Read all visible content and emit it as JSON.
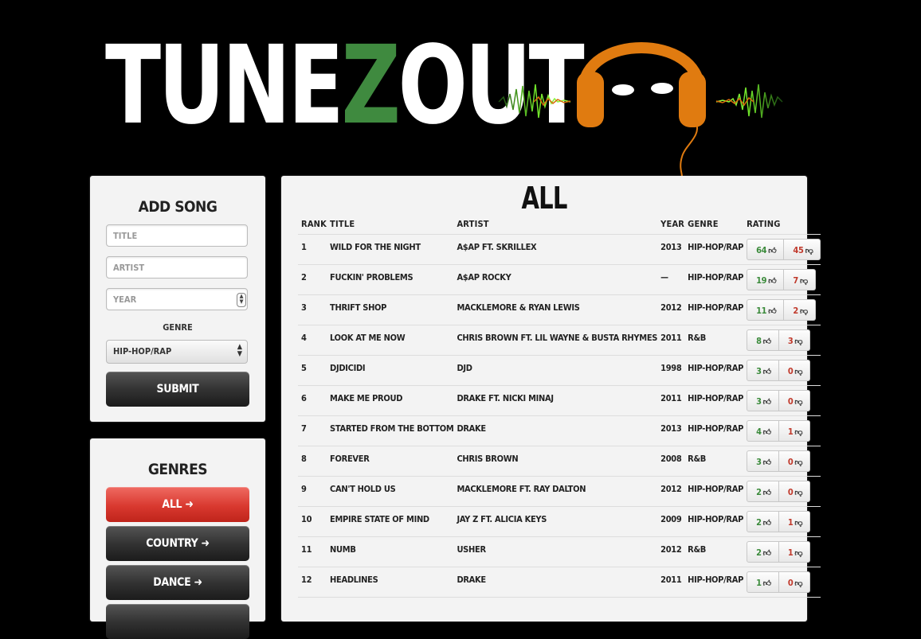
{
  "logo": {
    "part1": "TUNE",
    "part2": "Z",
    "part3": "OUT"
  },
  "add_song": {
    "heading": "ADD SONG",
    "title_placeholder": "TITLE",
    "artist_placeholder": "ARTIST",
    "year_placeholder": "YEAR",
    "genre_label": "GENRE",
    "genre_selected": "HIP-HOP/RAP",
    "submit_label": "SUBMIT"
  },
  "genres": {
    "heading": "GENRES",
    "items": [
      {
        "label": "ALL ➜"
      },
      {
        "label": "COUNTRY ➜"
      },
      {
        "label": "DANCE ➜"
      }
    ]
  },
  "main": {
    "title": "ALL",
    "columns": [
      "RANK",
      "TITLE",
      "ARTIST",
      "YEAR",
      "GENRE",
      "RATING"
    ],
    "rows": [
      {
        "rank": "1",
        "title": "WILD FOR THE NIGHT",
        "artist": "A$AP FT. SKRILLEX",
        "year": "2013",
        "genre": "HIP-HOP/RAP",
        "up": "64",
        "down": "45"
      },
      {
        "rank": "2",
        "title": "FUCKIN' PROBLEMS",
        "artist": "A$AP ROCKY",
        "year": "—",
        "genre": "HIP-HOP/RAP",
        "up": "19",
        "down": "7"
      },
      {
        "rank": "3",
        "title": "THRIFT SHOP",
        "artist": "MACKLEMORE & RYAN LEWIS",
        "year": "2012",
        "genre": "HIP-HOP/RAP",
        "up": "11",
        "down": "2"
      },
      {
        "rank": "4",
        "title": "LOOK AT ME NOW",
        "artist": "CHRIS BROWN FT. LIL WAYNE & BUSTA RHYMES",
        "year": "2011",
        "genre": "R&B",
        "up": "8",
        "down": "3"
      },
      {
        "rank": "5",
        "title": "DJDICIDI",
        "artist": "DJD",
        "year": "1998",
        "genre": "HIP-HOP/RAP",
        "up": "3",
        "down": "0"
      },
      {
        "rank": "6",
        "title": "MAKE ME PROUD",
        "artist": "DRAKE FT. NICKI MINAJ",
        "year": "2011",
        "genre": "HIP-HOP/RAP",
        "up": "3",
        "down": "0"
      },
      {
        "rank": "7",
        "title": "STARTED FROM THE BOTTOM",
        "artist": "DRAKE",
        "year": "2013",
        "genre": "HIP-HOP/RAP",
        "up": "4",
        "down": "1"
      },
      {
        "rank": "8",
        "title": "FOREVER",
        "artist": "CHRIS BROWN",
        "year": "2008",
        "genre": "R&B",
        "up": "3",
        "down": "0"
      },
      {
        "rank": "9",
        "title": "CAN'T HOLD US",
        "artist": "MACKLEMORE FT. RAY DALTON",
        "year": "2012",
        "genre": "HIP-HOP/RAP",
        "up": "2",
        "down": "0"
      },
      {
        "rank": "10",
        "title": "EMPIRE STATE OF MIND",
        "artist": "JAY Z FT. ALICIA KEYS",
        "year": "2009",
        "genre": "HIP-HOP/RAP",
        "up": "2",
        "down": "1"
      },
      {
        "rank": "11",
        "title": "NUMB",
        "artist": "USHER",
        "year": "2012",
        "genre": "R&B",
        "up": "2",
        "down": "1"
      },
      {
        "rank": "12",
        "title": "HEADLINES",
        "artist": "DRAKE",
        "year": "2011",
        "genre": "HIP-HOP/RAP",
        "up": "1",
        "down": "0"
      }
    ]
  },
  "colors": {
    "brand_green": "#3f8a3f",
    "headphone_orange": "#e07b10",
    "upvote_green": "#3a8a3a",
    "downvote_red": "#c0392b",
    "active_red": "#d9392f"
  },
  "icons": {
    "thumbs_up": "thumbs-up-icon",
    "thumbs_down": "thumbs-down-icon",
    "arrow": "arrow-right-icon"
  }
}
